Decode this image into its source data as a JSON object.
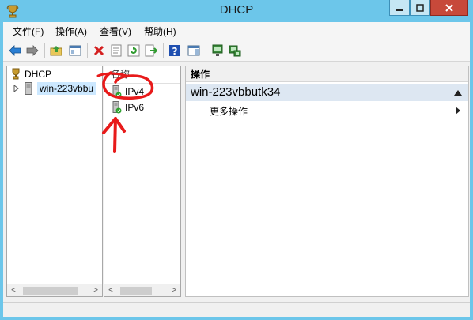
{
  "window": {
    "title": "DHCP",
    "icon": "dhcp-trophy-icon"
  },
  "menubar": {
    "items": [
      "文件(F)",
      "操作(A)",
      "查看(V)",
      "帮助(H)"
    ]
  },
  "toolbar": {
    "icons": [
      "back-arrow-icon",
      "forward-arrow-icon",
      "up-folder-icon",
      "show-hide-tree-icon",
      "delete-icon",
      "properties-icon",
      "refresh-icon",
      "export-list-icon",
      "help-icon",
      "show-action-pane-icon",
      "server-monitor-icon",
      "server-manage-icon"
    ]
  },
  "tree": {
    "root_label": "DHCP",
    "server_label": "win-223vbbu"
  },
  "list": {
    "header": "名称",
    "items": [
      "IPv4",
      "IPv6"
    ]
  },
  "actions": {
    "header": "操作",
    "group_title": "win-223vbbutk34",
    "more_label": "更多操作"
  },
  "colors": {
    "title_bg": "#6cc6ea",
    "close_red": "#c7493a",
    "selection": "#cce8ff",
    "annotation_red": "#e81a1a"
  }
}
